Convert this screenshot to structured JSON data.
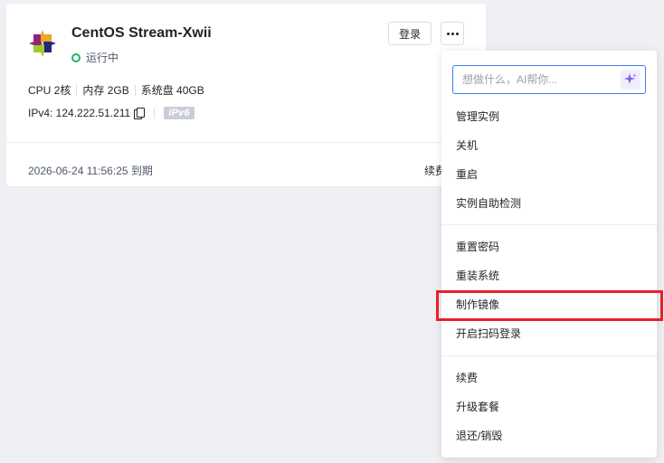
{
  "instance": {
    "name": "CentOS Stream-Xwii",
    "status": "运行中",
    "specs": [
      "CPU 2核",
      "内存 2GB",
      "系统盘 40GB"
    ],
    "ipv4": "IPv4: 124.222.51.211",
    "ipv6_tag": "IPv6",
    "expire": "2026-06-24 11:56:25 到期",
    "renew_label": "续费",
    "login_label": "登录",
    "status_color": "#21b36b"
  },
  "dropdown": {
    "ai_placeholder": "想做什么，AI帮你...",
    "groups": [
      [
        "管理实例",
        "关机",
        "重启",
        "实例自助检测"
      ],
      [
        "重置密码",
        "重装系统",
        "制作镜像",
        "开启扫码登录"
      ],
      [
        "续费",
        "升级套餐",
        "退还/销毁"
      ]
    ],
    "highlighted_item": "制作镜像",
    "highlight_color": "#e8202a"
  }
}
